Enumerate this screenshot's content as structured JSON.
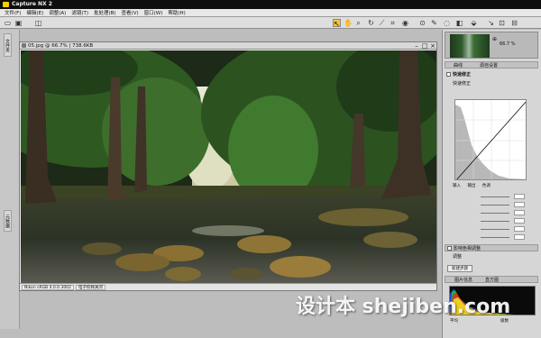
{
  "app": {
    "title": "Capture NX 2"
  },
  "menu": [
    "文件(F)",
    "编辑(E)",
    "调整(A)",
    "滤镜(T)",
    "批处理(B)",
    "查看(V)",
    "窗口(W)",
    "帮助(H)"
  ],
  "left_strip": {
    "tab_top": "文件夹",
    "tab_mid": "元数据"
  },
  "document": {
    "title": "05.jpg @ 66.7% | 738.6KB",
    "status_profile": "Nikon sRGB 4.0.0.3002",
    "status_mode": "电子校样关闭"
  },
  "navigator": {
    "zoom": "66.7 %"
  },
  "edit_list": {
    "section": "曲线",
    "dropdown_label": "源自设置",
    "quick_fix_title": "快速修正",
    "quick_fix_sub": "快速修正",
    "channels": [
      "输入",
      "输出",
      "色调"
    ],
    "color_adjust": "影响色相调整",
    "adjust_label": "调整",
    "new_step_button": "新建步骤"
  },
  "histogram": {
    "title": "图片信息",
    "section_label": "直方图",
    "footer_left": "平均",
    "footer_right": "级数"
  },
  "watermark": "设计本 shejiben.com",
  "colors": {
    "titlebar": "#0e0e0e",
    "panel": "#d6d6d6",
    "workspace": "#bdbdbd",
    "app_icon": "#f5d000"
  },
  "toolbar_icons": [
    "open-icon",
    "save-icon",
    "browser-icon",
    "direct-select-icon",
    "hand-icon",
    "zoom-icon",
    "rotate-icon",
    "straighten-icon",
    "crop-icon",
    "red-eye-icon",
    "control-point-icon",
    "brush-icon",
    "lasso-icon",
    "gradient-icon",
    "fill-icon"
  ]
}
